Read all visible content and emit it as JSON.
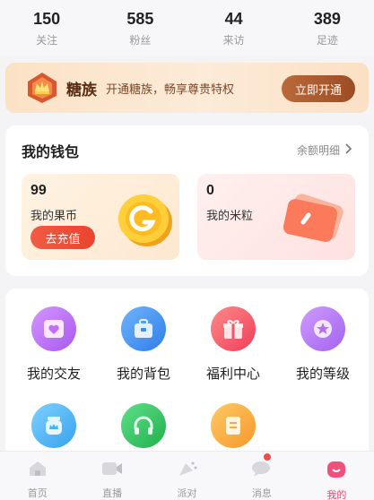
{
  "stats": [
    {
      "value": "150",
      "label": "关注"
    },
    {
      "value": "585",
      "label": "粉丝"
    },
    {
      "value": "44",
      "label": "来访"
    },
    {
      "value": "389",
      "label": "足迹"
    }
  ],
  "vip": {
    "title": "糖族",
    "desc": "开通糖族，畅享尊贵特权",
    "button": "立即开通"
  },
  "wallet": {
    "title": "我的钱包",
    "detail": "余额明细",
    "coin": {
      "value": "99",
      "label": "我的果币",
      "button": "去充值"
    },
    "mili": {
      "value": "0",
      "label": "我的米粒"
    }
  },
  "grid": [
    {
      "label": "我的交友",
      "icon": "heart-card-icon",
      "color": "#b86ef2"
    },
    {
      "label": "我的背包",
      "icon": "backpack-icon",
      "color": "#3a8ef0"
    },
    {
      "label": "福利中心",
      "icon": "gift-icon",
      "color": "#f2556a"
    },
    {
      "label": "我的等级",
      "icon": "star-badge-icon",
      "color": "#b574f0"
    },
    {
      "label": "",
      "icon": "crown-jar-icon",
      "color": "#45b4f2"
    },
    {
      "label": "",
      "icon": "headphones-icon",
      "color": "#2fc25b"
    },
    {
      "label": "",
      "icon": "document-icon",
      "color": "#f7a93a"
    }
  ],
  "tabs": [
    {
      "label": "首页",
      "icon": "home-icon"
    },
    {
      "label": "直播",
      "icon": "live-camera-icon"
    },
    {
      "label": "派对",
      "icon": "party-horn-icon"
    },
    {
      "label": "消息",
      "icon": "message-icon"
    },
    {
      "label": "我的",
      "icon": "profile-icon"
    }
  ],
  "colors": {
    "accent": "#e8476b",
    "vip_button": "#a4552b",
    "recharge": "#ee4f39"
  }
}
